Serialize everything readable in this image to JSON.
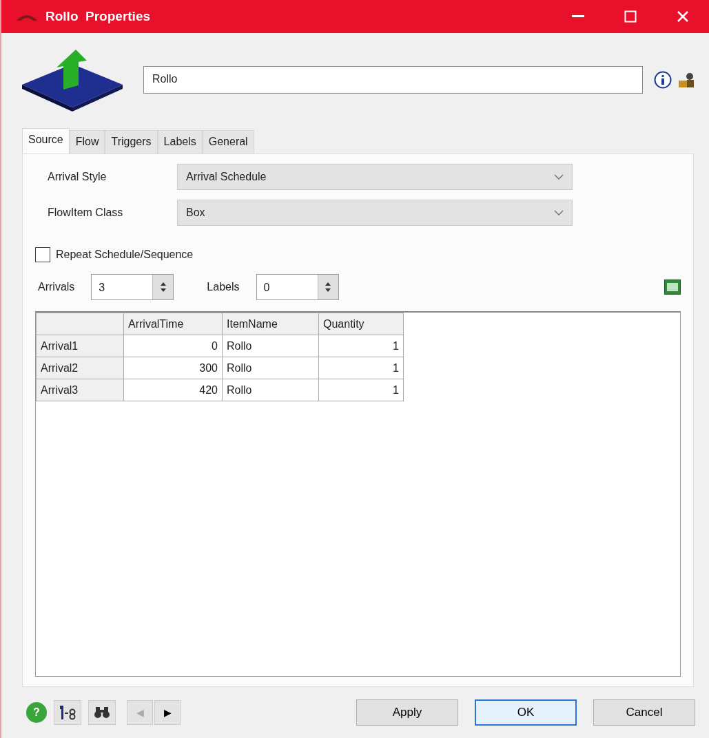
{
  "window": {
    "title": "Rollo  Properties"
  },
  "object_name": {
    "value": "Rollo"
  },
  "tabs": [
    {
      "label": "Source",
      "selected": true
    },
    {
      "label": "Flow",
      "selected": false
    },
    {
      "label": "Triggers",
      "selected": false
    },
    {
      "label": "Labels",
      "selected": false
    },
    {
      "label": "General",
      "selected": false
    }
  ],
  "fields": [
    {
      "label": "Arrival Style",
      "value": "Arrival Schedule"
    },
    {
      "label": "FlowItem Class",
      "value": "Box"
    }
  ],
  "repeat_checkbox": {
    "label": "Repeat Schedule/Sequence",
    "checked": false
  },
  "spinners": [
    {
      "label": "Arrivals",
      "value": "3"
    },
    {
      "label": "Labels",
      "value": "0"
    }
  ],
  "table": {
    "columns": [
      "ArrivalTime",
      "ItemName",
      "Quantity"
    ],
    "rows": [
      {
        "header": "Arrival1",
        "cells": [
          "0",
          "Rollo",
          "1"
        ]
      },
      {
        "header": "Arrival2",
        "cells": [
          "300",
          "Rollo",
          "1"
        ]
      },
      {
        "header": "Arrival3",
        "cells": [
          "420",
          "Rollo",
          "1"
        ]
      }
    ]
  },
  "footer": {
    "help_icon": "?",
    "nav": [
      {
        "symbol": "◀",
        "disabled": true
      },
      {
        "symbol": "▶",
        "disabled": false
      }
    ],
    "buttons": [
      {
        "label": "Apply",
        "default": false
      },
      {
        "label": "OK",
        "default": true
      },
      {
        "label": "Cancel",
        "default": false
      }
    ]
  }
}
